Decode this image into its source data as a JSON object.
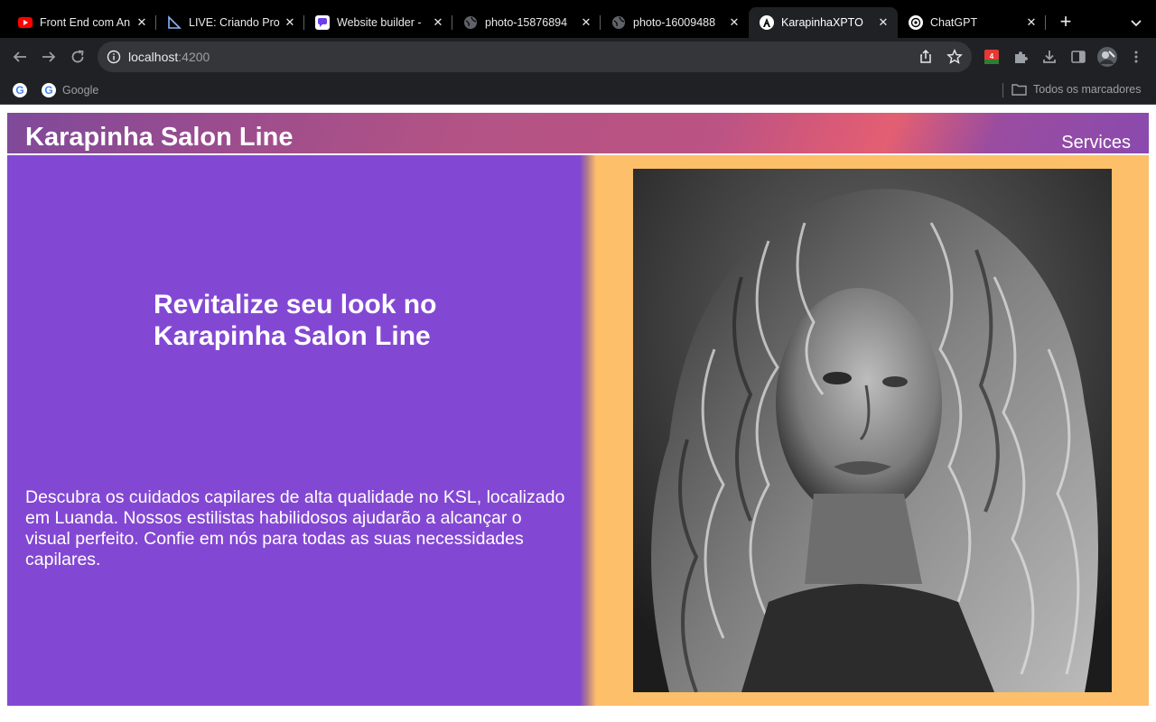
{
  "browser": {
    "tabs": [
      {
        "title": "Front End com An",
        "favicon": "youtube-icon",
        "active": false
      },
      {
        "title": "LIVE: Criando Pro",
        "favicon": "ruler-icon",
        "active": false
      },
      {
        "title": "Website builder -",
        "favicon": "chat-bubble-icon",
        "active": false
      },
      {
        "title": "photo-15876894",
        "favicon": "globe-icon",
        "active": false
      },
      {
        "title": "photo-16009488",
        "favicon": "globe-icon",
        "active": false
      },
      {
        "title": "KarapinhaXPTO",
        "favicon": "angular-icon",
        "active": true
      },
      {
        "title": "ChatGPT",
        "favicon": "openai-icon",
        "active": false
      }
    ],
    "url": {
      "host": "localhost",
      "port": ":4200"
    },
    "bookmarks": [
      {
        "label": "",
        "icon": "google-icon"
      },
      {
        "label": "Google",
        "icon": "google-icon"
      }
    ],
    "all_bookmarks_label": "Todos os marcadores",
    "colors": {
      "tabbar": "#000000",
      "toolbar": "#202124",
      "omnibox": "#35363a"
    }
  },
  "site": {
    "brand": "Karapinha Salon Line",
    "nav": {
      "services": "Services"
    },
    "hero": {
      "headline": "Revitalize seu look no Karapinha Salon Line",
      "description": "Descubra os cuidados capilares de alta qualidade no KSL, localizado em Luanda. Nossos estilistas habilidosos ajudarão a alcançar o visual perfeito. Confie em nós para todas as suas necessidades capilares.",
      "image": "portrait-photo-curly-hair"
    },
    "colors": {
      "purple": "#8348d3",
      "orange": "#fdbf69",
      "text": "#ffffff"
    }
  }
}
